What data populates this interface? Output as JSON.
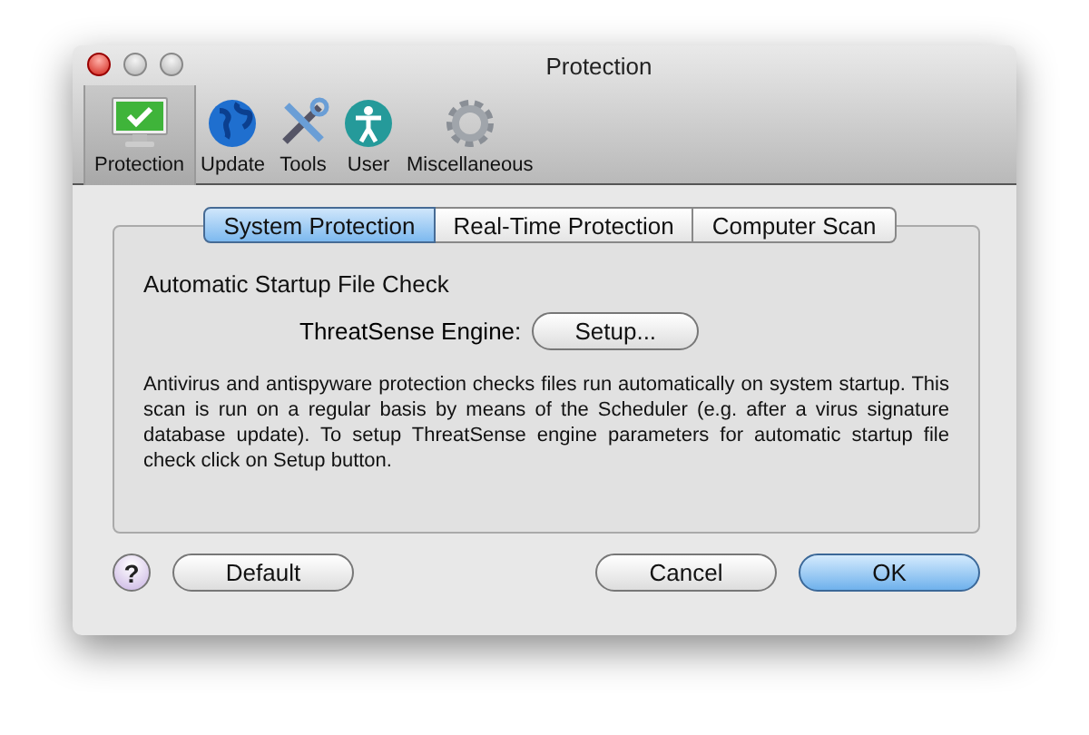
{
  "window": {
    "title": "Protection"
  },
  "toolbar": [
    {
      "label": "Protection",
      "kind": "monitor",
      "selected": true
    },
    {
      "label": "Update",
      "kind": "globe",
      "selected": false
    },
    {
      "label": "Tools",
      "kind": "tools",
      "selected": false
    },
    {
      "label": "User",
      "kind": "user",
      "selected": false
    },
    {
      "label": "Miscellaneous",
      "kind": "gear",
      "selected": false
    }
  ],
  "tabs": [
    {
      "label": "System Protection",
      "selected": true
    },
    {
      "label": "Real-Time Protection",
      "selected": false
    },
    {
      "label": "Computer Scan",
      "selected": false
    }
  ],
  "section_title": "Automatic Startup File Check",
  "engine": {
    "label": "ThreatSense Engine:",
    "button": "Setup..."
  },
  "description": "Antivirus and antispyware protection checks files run automatically on system startup. This scan is run on a regular basis by means of the Scheduler (e.g. after a virus signature database update). To setup ThreatSense engine parameters for automatic startup file check click on Setup button.",
  "buttons": [
    {
      "label": "?",
      "kind": "help"
    },
    {
      "label": "Default",
      "kind": "push"
    },
    {
      "label": "Cancel",
      "kind": "push"
    },
    {
      "label": "OK",
      "kind": "default"
    }
  ]
}
